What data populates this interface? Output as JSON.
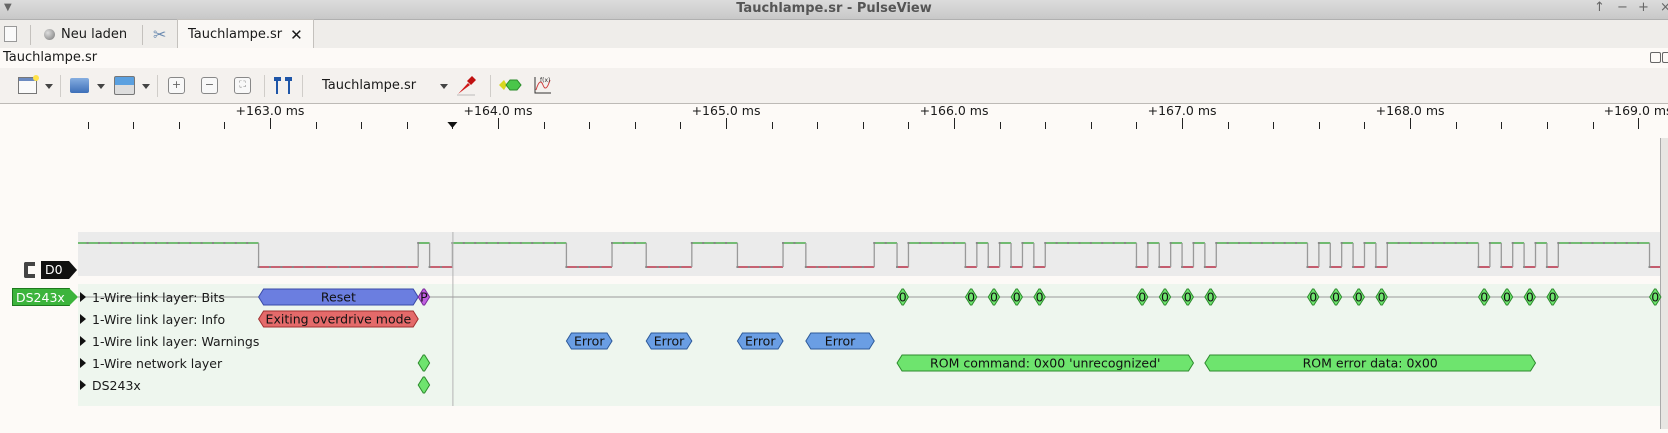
{
  "window": {
    "title": "Tauchlampe.sr - PulseView"
  },
  "tabs": {
    "reload_label": "Neu laden",
    "active_tab_label": "Tauchlampe.sr"
  },
  "document": {
    "title": "Tauchlampe.sr"
  },
  "toolbar": {
    "device_label": "Tauchlampe.sr",
    "icons": [
      "new-session-icon",
      "open-icon",
      "save-icon",
      "zoom-in-icon",
      "zoom-out-icon",
      "zoom-fit-icon",
      "cursors-icon",
      "probe-icon",
      "add-decoder-icon",
      "math-icon"
    ]
  },
  "ruler": {
    "unit": "ms",
    "view_start_ms": 162.158,
    "view_end_ms": 169.096,
    "major_labels": [
      "+163.0 ms",
      "+164.0 ms",
      "+165.0 ms",
      "+166.0 ms",
      "+167.0 ms",
      "+168.0 ms",
      "+169.0 ms"
    ],
    "cursor_ms": 163.8
  },
  "channels": {
    "d0": {
      "label": "D0",
      "sample_period_ms": 0.05,
      "initial_level": 1,
      "edges_ms": [
        162.95,
        163.65,
        163.7,
        163.8,
        164.3,
        164.5,
        164.65,
        164.85,
        165.05,
        165.25,
        165.35,
        165.65,
        165.75,
        165.8,
        166.05,
        166.1,
        166.15,
        166.2,
        166.25,
        166.3,
        166.35,
        166.4,
        166.8,
        166.85,
        166.9,
        166.95,
        167.0,
        167.05,
        167.1,
        167.15,
        167.55,
        167.6,
        167.65,
        167.7,
        167.75,
        167.8,
        167.85,
        167.9,
        168.3,
        168.35,
        168.4,
        168.45,
        168.5,
        168.55,
        168.6,
        168.65,
        169.05,
        169.1
      ],
      "high_color": "#2ea02e",
      "low_color": "#b0102a"
    }
  },
  "decoder": {
    "tag": "DS243x",
    "rows": [
      {
        "label": "1-Wire link layer: Bits",
        "annotations": [
          {
            "text": "Reset",
            "start": 162.95,
            "end": 163.65,
            "color": "#6b7ee0",
            "border": "#3a4aa8"
          },
          {
            "text": "P",
            "start": 163.65,
            "end": 163.7,
            "color": "#c060e0",
            "border": "#7a2a9a"
          },
          {
            "text": "0",
            "start": 165.75,
            "end": 165.8
          },
          {
            "text": "0",
            "start": 166.05,
            "end": 166.1
          },
          {
            "text": "0",
            "start": 166.15,
            "end": 166.2
          },
          {
            "text": "0",
            "start": 166.25,
            "end": 166.3
          },
          {
            "text": "0",
            "start": 166.35,
            "end": 166.4
          },
          {
            "text": "0",
            "start": 166.8,
            "end": 166.85
          },
          {
            "text": "0",
            "start": 166.9,
            "end": 166.95
          },
          {
            "text": "0",
            "start": 167.0,
            "end": 167.05
          },
          {
            "text": "0",
            "start": 167.1,
            "end": 167.15
          },
          {
            "text": "0",
            "start": 167.55,
            "end": 167.6
          },
          {
            "text": "0",
            "start": 167.65,
            "end": 167.7
          },
          {
            "text": "0",
            "start": 167.75,
            "end": 167.8
          },
          {
            "text": "0",
            "start": 167.85,
            "end": 167.9
          },
          {
            "text": "0",
            "start": 168.3,
            "end": 168.35
          },
          {
            "text": "0",
            "start": 168.4,
            "end": 168.45
          },
          {
            "text": "0",
            "start": 168.5,
            "end": 168.55
          },
          {
            "text": "0",
            "start": 168.6,
            "end": 168.65
          },
          {
            "text": "0",
            "start": 169.05,
            "end": 169.1
          }
        ]
      },
      {
        "label": "1-Wire link layer: Info",
        "annotations": [
          {
            "text": "Exiting overdrive mode",
            "start": 162.95,
            "end": 163.65,
            "color": "#e46a6a",
            "border": "#a03030"
          }
        ]
      },
      {
        "label": "1-Wire link layer: Warnings",
        "annotations": [
          {
            "text": "Error",
            "start": 164.3,
            "end": 164.5,
            "color": "#6a9ee4",
            "border": "#2d5a9a"
          },
          {
            "text": "Error",
            "start": 164.65,
            "end": 164.85,
            "color": "#6a9ee4",
            "border": "#2d5a9a"
          },
          {
            "text": "Error",
            "start": 165.05,
            "end": 165.25,
            "color": "#6a9ee4",
            "border": "#2d5a9a"
          },
          {
            "text": "Error",
            "start": 165.35,
            "end": 165.65,
            "color": "#6a9ee4",
            "border": "#2d5a9a"
          }
        ]
      },
      {
        "label": "1-Wire network layer",
        "annotations": [
          {
            "text": "",
            "start": 163.65,
            "end": 163.7
          },
          {
            "text": "ROM command: 0x00 'unrecognized'",
            "start": 165.75,
            "end": 167.05
          },
          {
            "text": "ROM error data: 0x00",
            "start": 167.1,
            "end": 168.55
          }
        ]
      },
      {
        "label": "DS243x",
        "annotations": [
          {
            "text": "",
            "start": 163.65,
            "end": 163.7
          }
        ]
      }
    ],
    "default_color": "#6ee46e",
    "default_border": "#2e8a2e"
  }
}
